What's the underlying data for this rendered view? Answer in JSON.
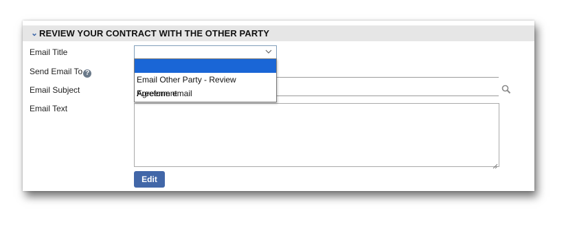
{
  "section": {
    "collapse_glyph": "⌄",
    "title": "REVIEW YOUR CONTRACT WITH THE OTHER PARTY"
  },
  "form": {
    "email_title_label": "Email Title",
    "send_email_to_label": "Send Email To",
    "help_glyph": "?",
    "email_subject_label": "Email Subject",
    "email_text_label": "Email Text",
    "email_title_value": "",
    "send_email_to_value": "",
    "email_subject_value": "",
    "email_text_value": ""
  },
  "dropdown": {
    "options": [
      {
        "label": "",
        "selected": true
      },
      {
        "label": "Email Other Party - Review Agreement",
        "selected": false
      },
      {
        "label": "Freeform email",
        "selected": false
      }
    ]
  },
  "buttons": {
    "edit_label": "Edit"
  },
  "colors": {
    "accent": "#4267a8",
    "selected_option": "#1a66d6",
    "header_bg": "#e6e6e6"
  },
  "icons": {
    "collapse": "chevron-down-icon",
    "help": "help-icon",
    "search": "search-icon",
    "dropdown_caret": "chevron-down-icon"
  }
}
